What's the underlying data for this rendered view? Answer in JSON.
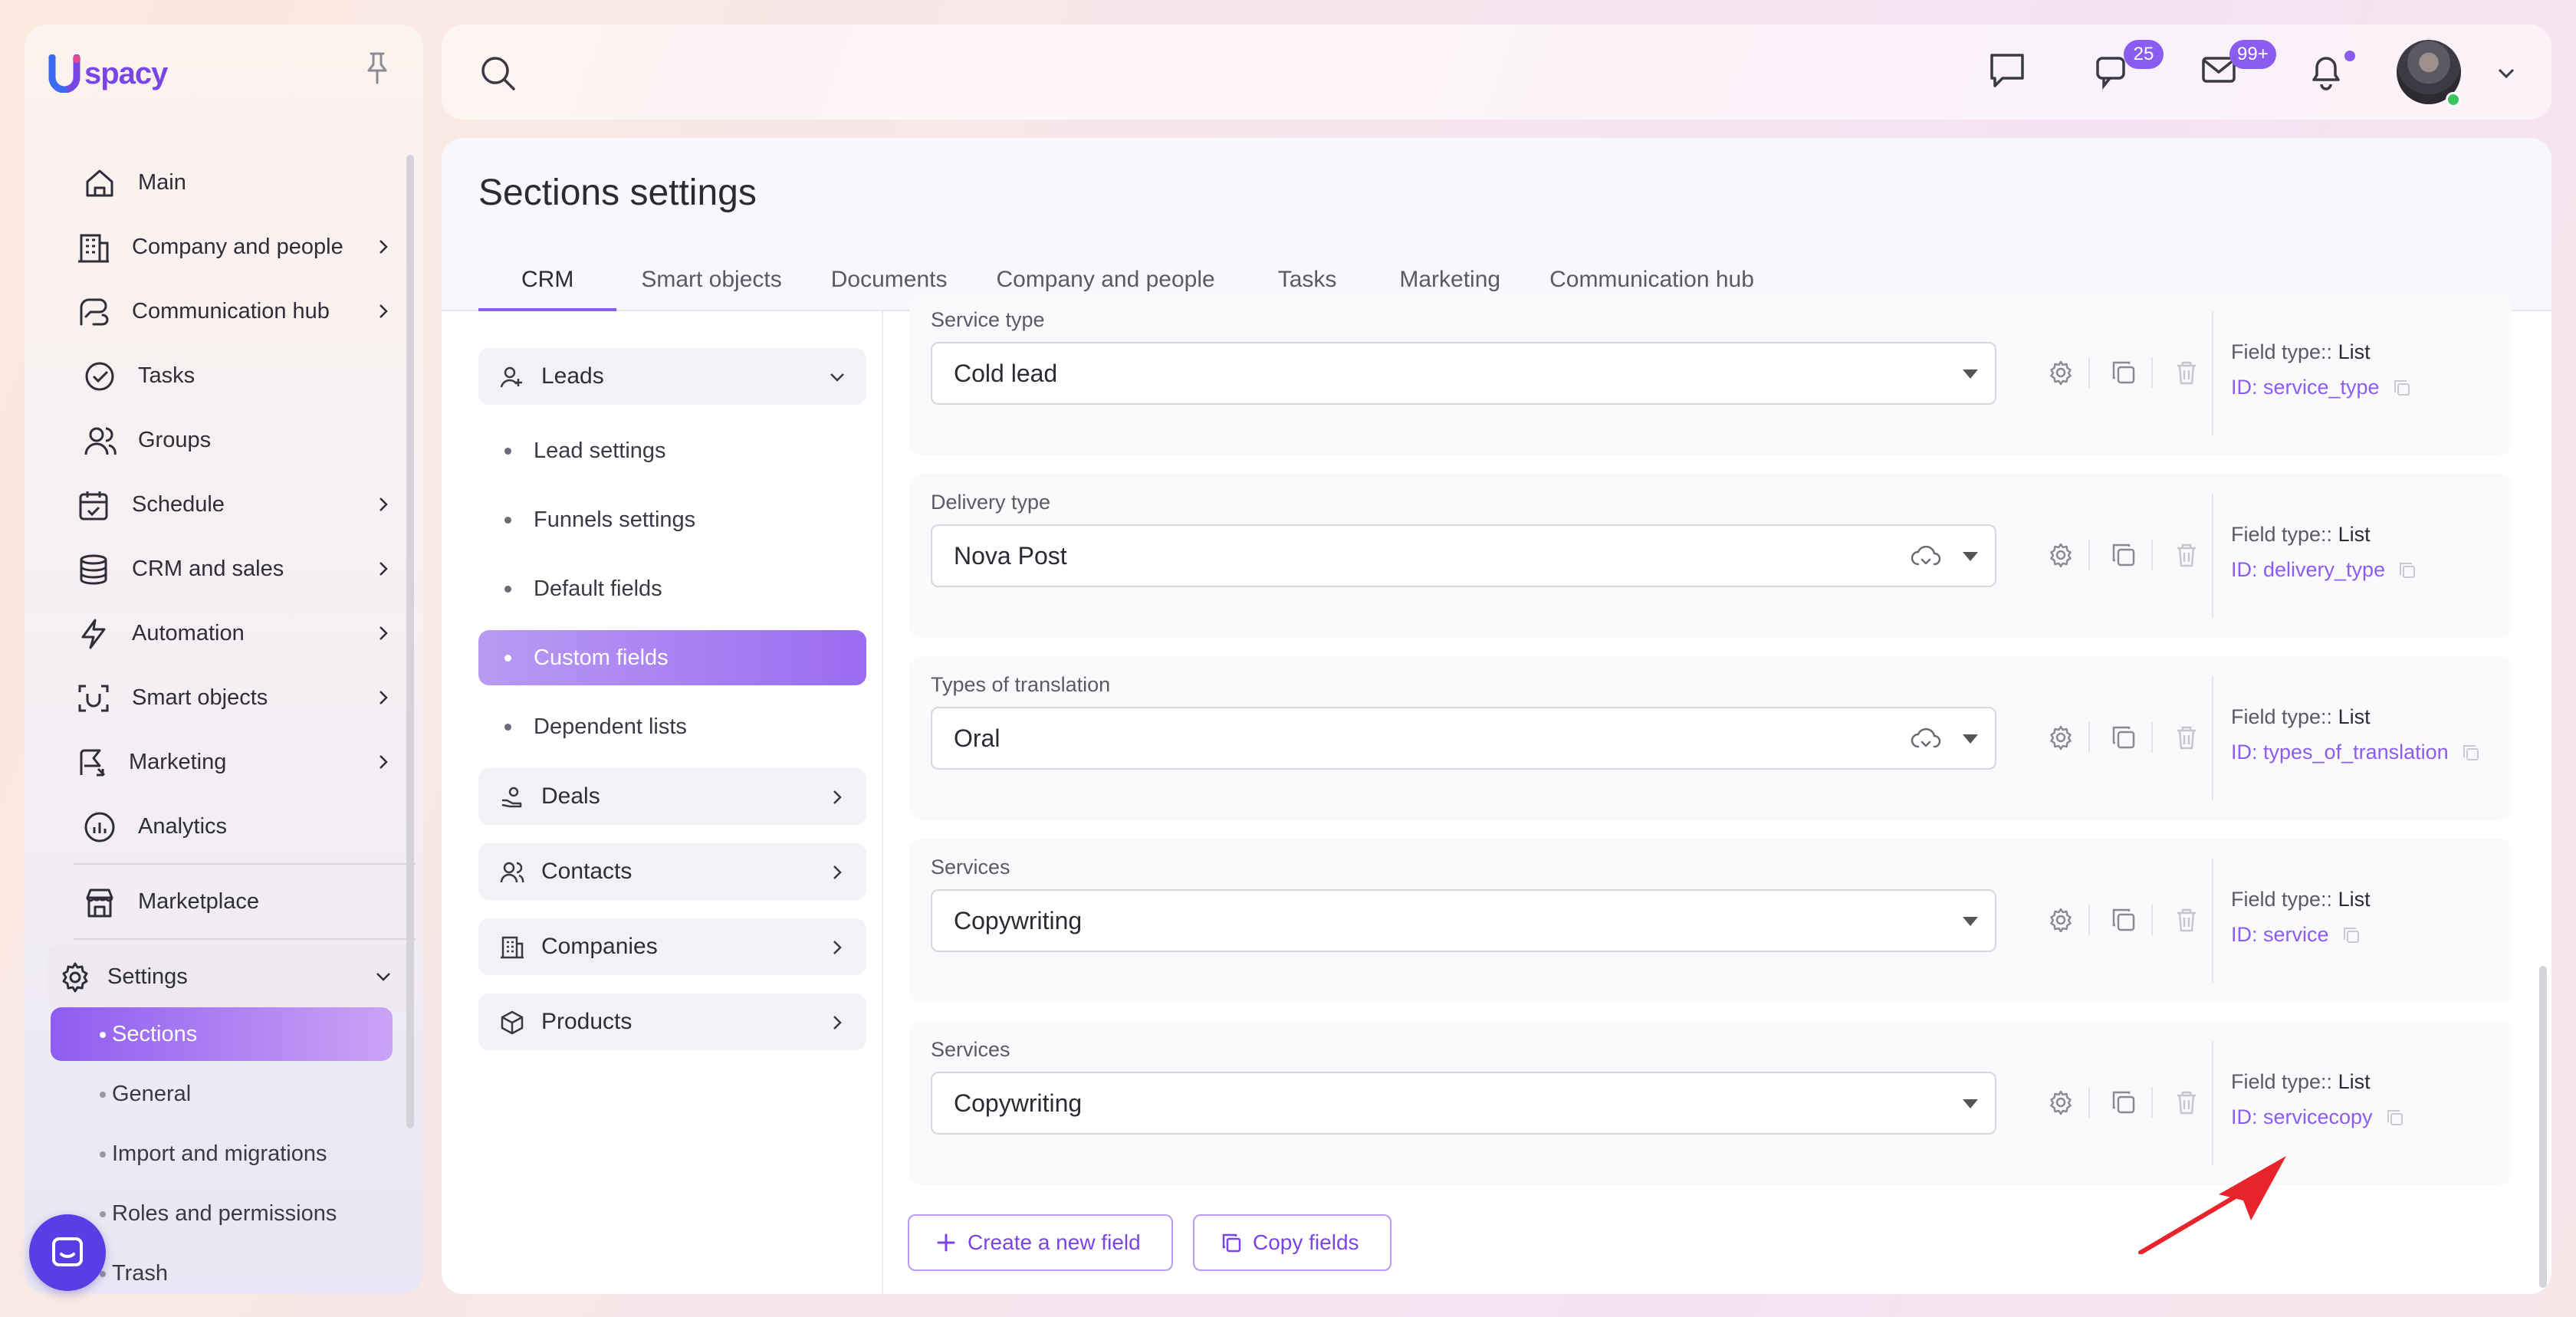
{
  "app": {
    "logo_text": "spacy"
  },
  "sidebar": {
    "items": [
      {
        "label": "Main",
        "icon": "home-icon",
        "has_chevron": false
      },
      {
        "label": "Company and people",
        "icon": "building-icon",
        "has_chevron": true
      },
      {
        "label": "Communication hub",
        "icon": "communication-icon",
        "has_chevron": true
      },
      {
        "label": "Tasks",
        "icon": "check-circle-icon",
        "has_chevron": false
      },
      {
        "label": "Groups",
        "icon": "users-icon",
        "has_chevron": false
      },
      {
        "label": "Schedule",
        "icon": "calendar-icon",
        "has_chevron": true
      },
      {
        "label": "CRM and sales",
        "icon": "database-icon",
        "has_chevron": true
      },
      {
        "label": "Automation",
        "icon": "lightning-icon",
        "has_chevron": true
      },
      {
        "label": "Smart objects",
        "icon": "scan-icon",
        "has_chevron": true
      },
      {
        "label": "Marketing",
        "icon": "marketing-icon",
        "has_chevron": true
      },
      {
        "label": "Analytics",
        "icon": "analytics-icon",
        "has_chevron": false
      }
    ],
    "marketplace": "Marketplace",
    "settings": "Settings",
    "settings_sub": [
      "Sections",
      "General",
      "Import and migrations",
      "Roles and permissions",
      "Trash"
    ]
  },
  "topbar": {
    "chat_badge": "25",
    "mail_badge": "99+"
  },
  "page": {
    "title": "Sections settings",
    "tabs": [
      "CRM",
      "Smart objects",
      "Documents",
      "Company and people",
      "Tasks",
      "Marketing",
      "Communication hub"
    ]
  },
  "modules": {
    "leads": "Leads",
    "leads_sub": [
      "Lead settings",
      "Funnels settings",
      "Default fields",
      "Custom fields",
      "Dependent lists"
    ],
    "others": [
      "Deals",
      "Contacts",
      "Companies",
      "Products"
    ]
  },
  "fields": [
    {
      "label": "Service type",
      "value": "Cold lead",
      "cloud": false,
      "type_label": "Field type::",
      "type": "List",
      "id": "ID: service_type"
    },
    {
      "label": "Delivery type",
      "value": "Nova Post",
      "cloud": true,
      "type_label": "Field type::",
      "type": "List",
      "id": "ID: delivery_type"
    },
    {
      "label": "Types of translation",
      "value": "Oral",
      "cloud": true,
      "type_label": "Field type::",
      "type": "List",
      "id": "ID: types_of_translation"
    },
    {
      "label": "Services",
      "value": "Copywriting",
      "cloud": false,
      "type_label": "Field type::",
      "type": "List",
      "id": "ID: service"
    },
    {
      "label": "Services",
      "value": "Copywriting",
      "cloud": false,
      "type_label": "Field type::",
      "type": "List",
      "id": "ID: servicecopy"
    }
  ],
  "actions": {
    "create": "Create a new field",
    "copy": "Copy fields"
  },
  "colors": {
    "accent": "#8b5cf0",
    "annotation_arrow": "#e8232b"
  }
}
